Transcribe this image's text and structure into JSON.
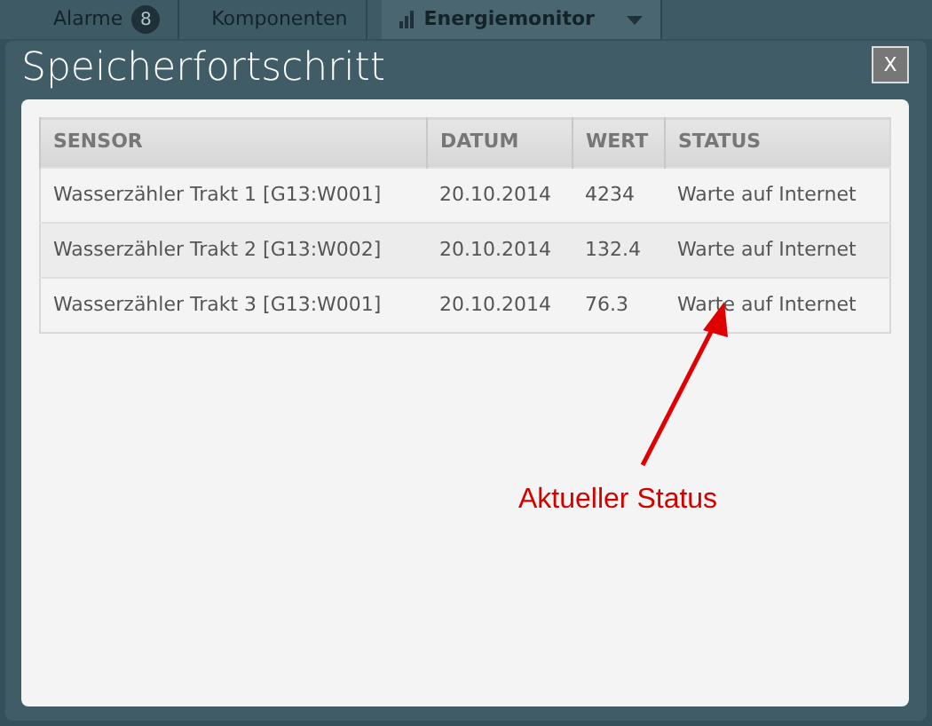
{
  "background_tabs": [
    {
      "label": "Alarme",
      "badge": "8",
      "kind": "badge",
      "selected": false
    },
    {
      "label": "Komponenten",
      "kind": "plain",
      "selected": false
    },
    {
      "label": "Energiemonitor",
      "kind": "dropdown",
      "selected": true
    }
  ],
  "dialog": {
    "title": "Speicherfortschritt",
    "close": "X",
    "table": {
      "columns": [
        "SENSOR",
        "DATUM",
        "WERT",
        "STATUS"
      ],
      "rows": [
        [
          "Wasserzähler Trakt 1 [G13:W001]",
          "20.10.2014",
          "4234",
          "Warte auf Internet"
        ],
        [
          "Wasserzähler Trakt 2 [G13:W002]",
          "20.10.2014",
          "132.4",
          "Warte auf Internet"
        ],
        [
          "Wasserzähler Trakt 3 [G13:W001]",
          "20.10.2014",
          "76.3",
          "Warte auf Internet"
        ]
      ]
    }
  },
  "annotation": {
    "text": "Aktueller Status"
  }
}
